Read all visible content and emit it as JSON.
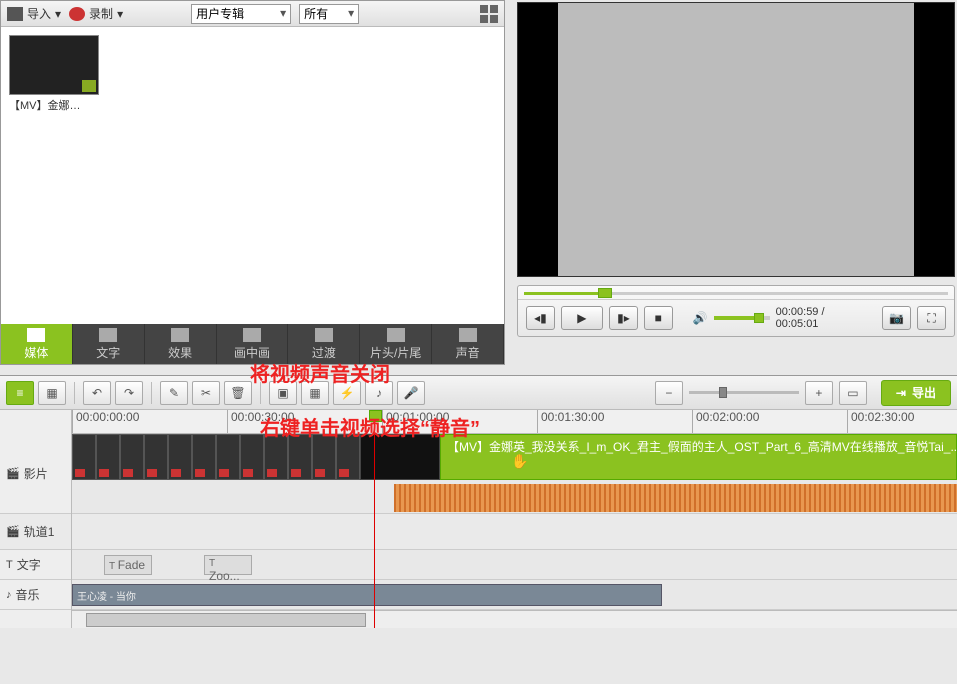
{
  "toolbar": {
    "import": "导入",
    "record": "录制",
    "album_select": "用户专辑",
    "filter_select": "所有"
  },
  "thumb": {
    "caption": "【MV】金娜…"
  },
  "tabs": {
    "media": "媒体",
    "text": "文字",
    "effect": "效果",
    "pip": "画中画",
    "transition": "过渡",
    "credits": "片头/片尾",
    "sound": "声音"
  },
  "player": {
    "time": "00:00:59 / 00:05:01"
  },
  "export": "导出",
  "ruler": {
    "t0": "00:00:00:00",
    "t1": "00:00:30:00",
    "t2": "00:01:00:00",
    "t3": "00:01:30:00",
    "t4": "00:02:00:00",
    "t5": "00:02:30:00"
  },
  "tracks": {
    "video": "影片",
    "track1": "轨道1",
    "text": "文字",
    "music": "音乐"
  },
  "clip": {
    "selected": "【MV】金娜英_我没关系_I_m_OK_君主_假面的主人_OST_Part_6_高清MV在线播放_音悦Tai_...",
    "text1": "Fade",
    "text2": "Zoo...",
    "music": "王心凌 - 当你"
  },
  "annot": {
    "l1": "将视频声音关闭",
    "l2": "右键单击视频选择“静音”"
  }
}
